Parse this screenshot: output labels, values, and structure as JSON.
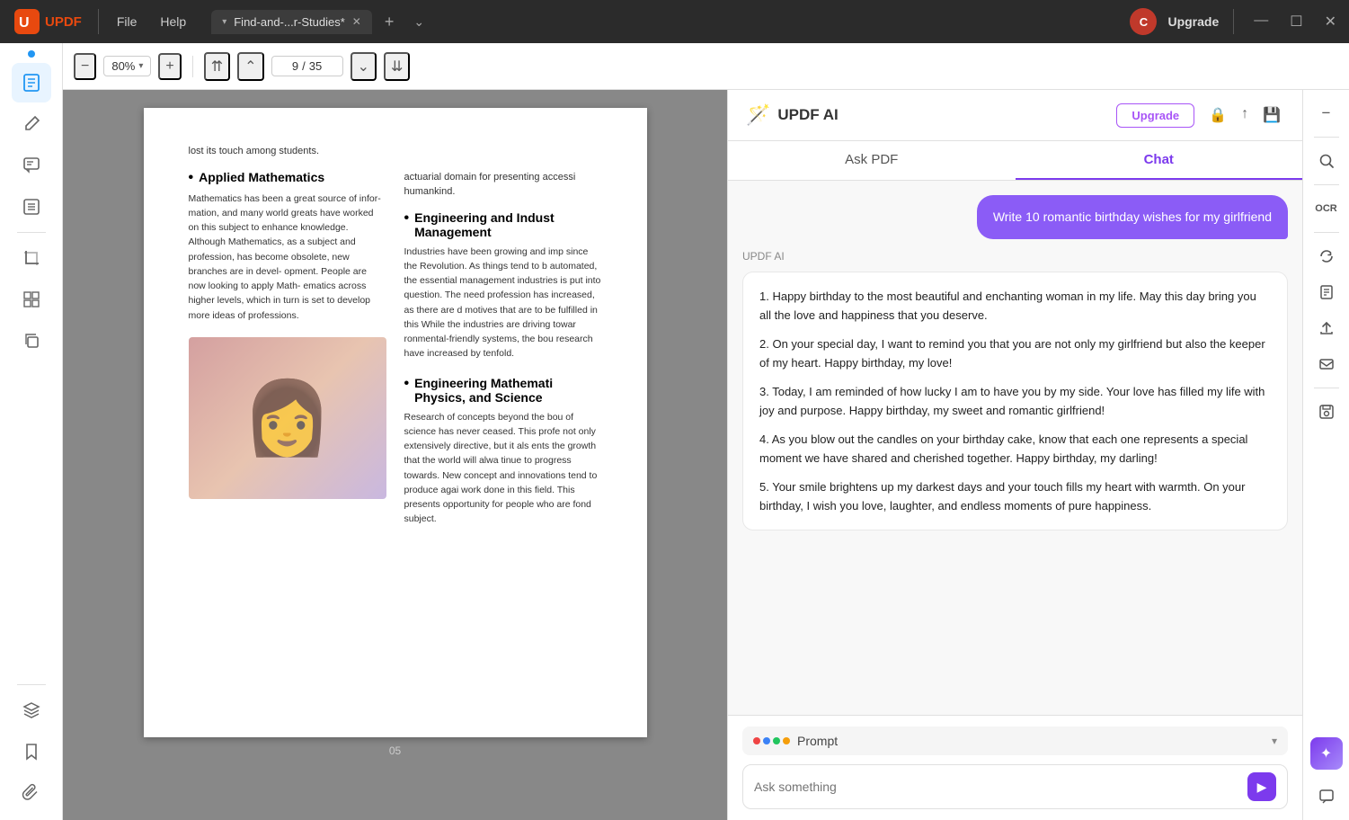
{
  "titlebar": {
    "app_name": "UPDF",
    "menu_file": "File",
    "menu_help": "Help",
    "tab_name": "Find-and-...r-Studies*",
    "tab_add": "+",
    "upgrade_label": "Upgrade",
    "avatar_letter": "C"
  },
  "toolbar": {
    "zoom_value": "80%",
    "page_current": "9",
    "page_total": "35"
  },
  "pdf": {
    "lost_touch_text": "lost its touch among students.",
    "actuarial_text": "actuarial domain for presenting accessi humankind.",
    "applied_math_title": "Applied Mathematics",
    "applied_math_body": "Mathematics has been a great source of infor- mation, and many world greats have worked on this subject to enhance knowledge. Although Mathematics, as a subject and profession, has become obsolete, new branches are in devel- opment. People are now looking to apply Math- ematics across higher levels, which in turn is set to develop more ideas of professions.",
    "eng_indust_title": "Engineering and Indust Management",
    "eng_indust_body": "Industries have been growing and imp since the Revolution. As things tend to b automated, the essential management industries is put into question. The need profession has increased, as there are d motives that are to be fulfilled in this While the industries are driving towar ronmental-friendly systems, the bou research have increased by tenfold.",
    "eng_math_title": "Engineering Mathemati Physics, and Science",
    "eng_math_body": "Research of concepts beyond the bou of science has never ceased. This profe not only extensively directive, but it als ents the growth that the world will alwa tinue to progress towards. New concept and innovations tend to produce agai work done in this field. This presents opportunity for people who are fond subject.",
    "page_number": "05"
  },
  "ai_panel": {
    "title": "UPDF AI",
    "upgrade_btn": "Upgrade",
    "tab_ask_pdf": "Ask PDF",
    "tab_chat": "Chat",
    "active_tab": "chat",
    "user_message": "Write 10 romantic birthday wishes for my girlfriend",
    "ai_label": "UPDF AI",
    "ai_response": {
      "line1": "1. Happy birthday to the most beautiful and enchanting woman in my life. May this day bring you all the love and happiness that you deserve.",
      "line2": "2. On your special day, I want to remind you that you are not only my girlfriend but also the keeper of my heart. Happy birthday, my love!",
      "line3": "3. Today, I am reminded of how lucky I am to have you by my side. Your love has filled my life with joy and purpose. Happy birthday, my sweet and romantic girlfriend!",
      "line4": "4. As you blow out the candles on your birthday cake, know that each one represents a special moment we have shared and cherished together. Happy birthday, my darling!",
      "line5": "5. Your smile brightens up my darkest days and your touch fills my heart with warmth. On your birthday, I wish you love, laughter, and endless moments of pure happiness."
    },
    "prompt_label": "Prompt",
    "input_placeholder": "Ask something"
  },
  "icons": {
    "minimize": "—",
    "maximize": "☐",
    "close": "✕",
    "prev_page": "‹",
    "next_page": "›",
    "first_page": "«",
    "last_page": "»",
    "zoom_in": "+",
    "zoom_out": "−",
    "send": "▶",
    "prompt_down": "▾"
  }
}
